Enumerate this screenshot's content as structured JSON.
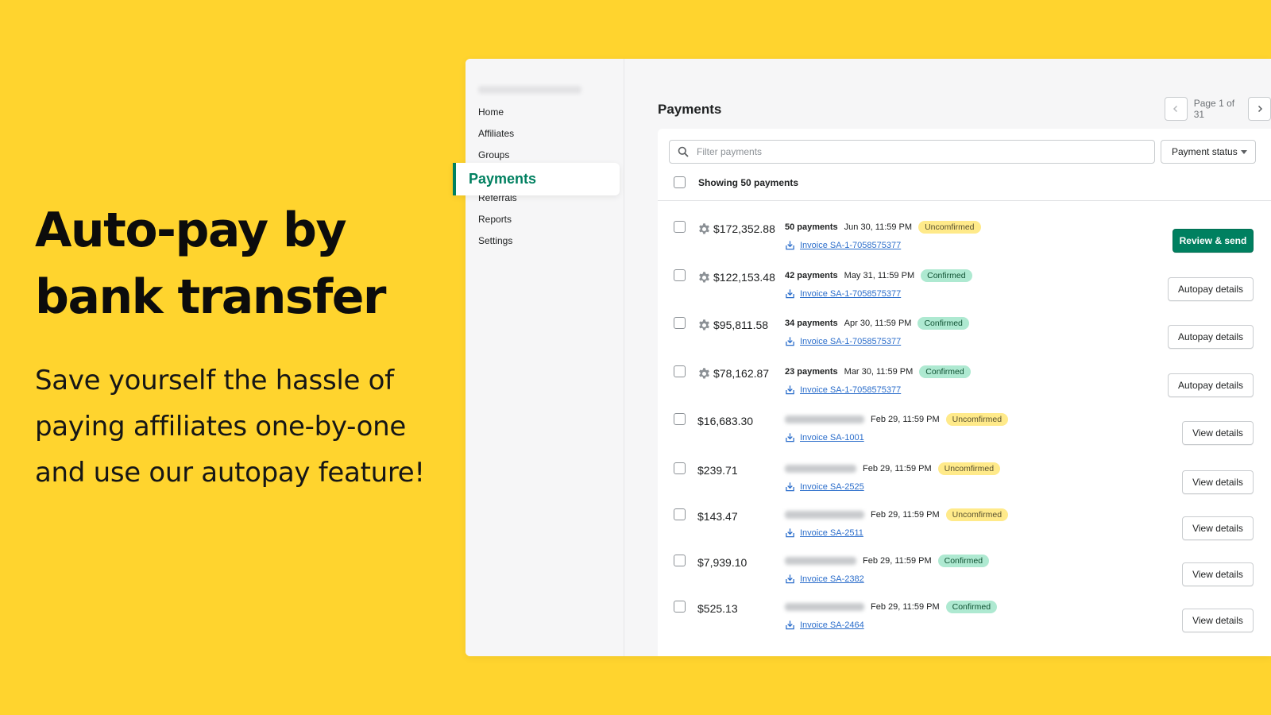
{
  "hero": {
    "title_line1": "Auto-pay by",
    "title_line2": "bank transfer",
    "description": "Save yourself the hassle of paying affiliates one-by-one and use our autopay feature!"
  },
  "sidebar": {
    "items": [
      {
        "label": "Home"
      },
      {
        "label": "Affiliates"
      },
      {
        "label": "Groups"
      },
      {
        "label": "Payments"
      },
      {
        "label": "Referrals"
      },
      {
        "label": "Reports"
      },
      {
        "label": "Settings"
      }
    ],
    "active_label": "Payments",
    "accent_color": "#008060"
  },
  "main": {
    "title": "Payments",
    "pager": {
      "text": "Page 1 of 31",
      "prev_icon": "chevron-left-icon",
      "next_icon": "chevron-right-icon"
    },
    "search": {
      "placeholder": "Filter payments",
      "value": "",
      "icon": "search-icon"
    },
    "status_filter": {
      "label": "Payment status"
    },
    "select_all_label": "Showing 50 payments"
  },
  "payments": [
    {
      "amount": "$172,352.88",
      "autopay": true,
      "count": "50 payments",
      "date": "Jun 30, 11:59 PM",
      "status": "Uncomfirmed",
      "status_type": "unconfirmed",
      "invoice": "Invoice SA-1-7058575377",
      "action": "Review & send",
      "primary": true
    },
    {
      "amount": "$122,153.48",
      "autopay": true,
      "count": "42 payments",
      "date": "May 31, 11:59 PM",
      "status": "Confirmed",
      "status_type": "confirmed",
      "invoice": "Invoice SA-1-7058575377",
      "action": "Autopay details",
      "primary": false
    },
    {
      "amount": "$95,811.58",
      "autopay": true,
      "count": "34 payments",
      "date": "Apr 30, 11:59 PM",
      "status": "Confirmed",
      "status_type": "confirmed",
      "invoice": "Invoice SA-1-7058575377",
      "action": "Autopay details",
      "primary": false
    },
    {
      "amount": "$78,162.87",
      "autopay": true,
      "count": "23 payments",
      "date": "Mar 30, 11:59 PM",
      "status": "Confirmed",
      "status_type": "confirmed",
      "invoice": "Invoice SA-1-7058575377",
      "action": "Autopay details",
      "primary": false
    },
    {
      "amount": "$16,683.30",
      "autopay": false,
      "count": "",
      "date": "Feb 29, 11:59 PM",
      "status": "Uncomfirmed",
      "status_type": "unconfirmed",
      "invoice": "Invoice SA-1001",
      "action": "View details",
      "primary": false
    },
    {
      "amount": "$239.71",
      "autopay": false,
      "count": "",
      "date": "Feb 29, 11:59 PM",
      "status": "Uncomfirmed",
      "status_type": "unconfirmed",
      "invoice": "Invoice SA-2525",
      "action": "View details",
      "primary": false
    },
    {
      "amount": "$143.47",
      "autopay": false,
      "count": "",
      "date": "Feb 29, 11:59 PM",
      "status": "Uncomfirmed",
      "status_type": "unconfirmed",
      "invoice": "Invoice SA-2511",
      "action": "View details",
      "primary": false
    },
    {
      "amount": "$7,939.10",
      "autopay": false,
      "count": "",
      "date": "Feb 29, 11:59 PM",
      "status": "Confirmed",
      "status_type": "confirmed",
      "invoice": "Invoice SA-2382",
      "action": "View details",
      "primary": false
    },
    {
      "amount": "$525.13",
      "autopay": false,
      "count": "",
      "date": "Feb 29, 11:59 PM",
      "status": "Confirmed",
      "status_type": "confirmed",
      "invoice": "Invoice SA-2464",
      "action": "View details",
      "primary": false
    }
  ],
  "colors": {
    "background": "#FFD42E",
    "primary_button": "#008060",
    "link": "#2c6ecb"
  }
}
